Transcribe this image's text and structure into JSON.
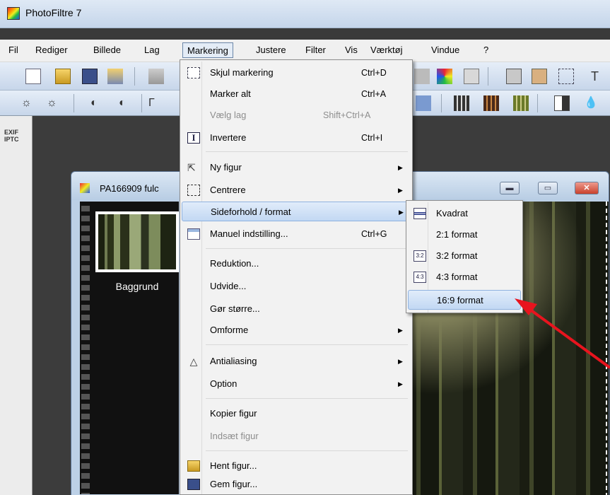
{
  "app": {
    "title": "PhotoFiltre 7"
  },
  "menubar": {
    "items": [
      "Fil",
      "Rediger",
      "Billede",
      "Lag",
      "Markering",
      "Justere",
      "Filter",
      "Vis",
      "Værktøj",
      "Vindue",
      "?"
    ]
  },
  "left_strip": {
    "label": "EXIF\nIPTC"
  },
  "document": {
    "title": "PA166909 fulc",
    "layer_label": "Baggrund"
  },
  "menu": {
    "items": [
      {
        "label": "Skjul markering",
        "shortcut": "Ctrl+D"
      },
      {
        "label": "Marker alt",
        "shortcut": "Ctrl+A"
      },
      {
        "label": "Vælg lag",
        "shortcut": "Shift+Ctrl+A"
      },
      {
        "label": "Invertere",
        "shortcut": "Ctrl+I"
      },
      {
        "label": "Ny figur",
        "shortcut": ""
      },
      {
        "label": "Centrere",
        "shortcut": ""
      },
      {
        "label": "Sideforhold / format",
        "shortcut": ""
      },
      {
        "label": "Manuel indstilling...",
        "shortcut": "Ctrl+G"
      },
      {
        "label": "Reduktion...",
        "shortcut": ""
      },
      {
        "label": "Udvide...",
        "shortcut": ""
      },
      {
        "label": "Gør større...",
        "shortcut": ""
      },
      {
        "label": "Omforme",
        "shortcut": ""
      },
      {
        "label": "Antialiasing",
        "shortcut": ""
      },
      {
        "label": "Option",
        "shortcut": ""
      },
      {
        "label": "Kopier figur",
        "shortcut": ""
      },
      {
        "label": "Indsæt figur",
        "shortcut": ""
      },
      {
        "label": "Hent figur...",
        "shortcut": ""
      },
      {
        "label": "Gem figur...",
        "shortcut": ""
      }
    ]
  },
  "submenu": {
    "items": [
      {
        "label": "Kvadrat",
        "icon": ""
      },
      {
        "label": "2:1 format",
        "icon": ""
      },
      {
        "label": "3:2 format",
        "icon": "3:2"
      },
      {
        "label": "4:3 format",
        "icon": "4:3"
      },
      {
        "label": "16:9 format",
        "icon": ""
      }
    ]
  },
  "colors": {
    "highlight": "#c2d8f3",
    "arrow": "#e8141e"
  }
}
